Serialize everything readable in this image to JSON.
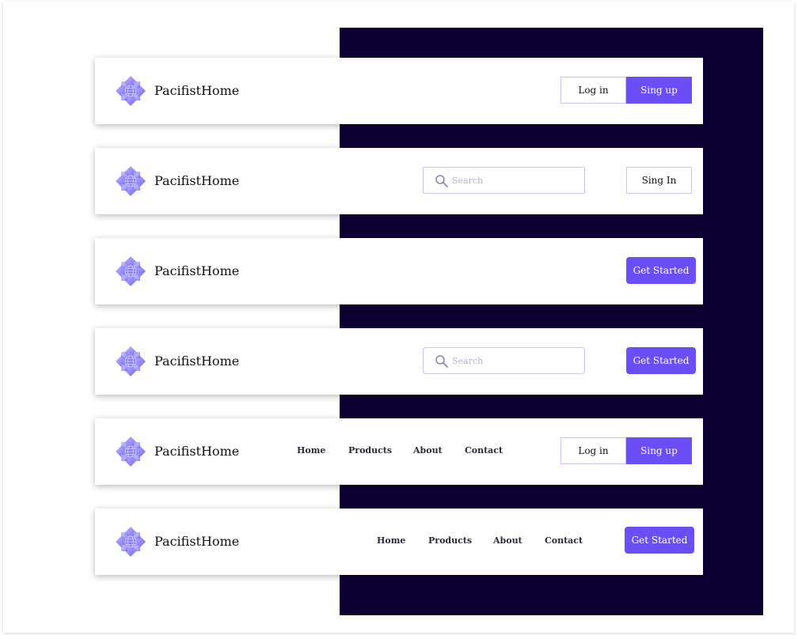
{
  "brand": {
    "name": "PacifistHome",
    "accent": "#6b4ef5",
    "panel_color": "#0c0033"
  },
  "navbars": [
    {
      "variant": "login-signup",
      "brand": "PacifistHome",
      "login": "Log in",
      "signup": "Sing up"
    },
    {
      "variant": "search-signin",
      "brand": "PacifistHome",
      "search_placeholder": "Search",
      "signin": "Sing In"
    },
    {
      "variant": "get-started",
      "brand": "PacifistHome",
      "cta": "Get Started"
    },
    {
      "variant": "search-get-started",
      "brand": "PacifistHome",
      "search_placeholder": "Search",
      "cta": "Get Started"
    },
    {
      "variant": "links-login-signup",
      "brand": "PacifistHome",
      "links": [
        "Home",
        "Products",
        "About",
        "Contact"
      ],
      "login": "Log in",
      "signup": "Sing up"
    },
    {
      "variant": "links-get-started",
      "brand": "PacifistHome",
      "links": [
        "Home",
        "Products",
        "About",
        "Contact"
      ],
      "cta": "Get Started"
    }
  ],
  "icons": {
    "logo": "flower-globe-icon",
    "search": "magnifier-icon"
  }
}
